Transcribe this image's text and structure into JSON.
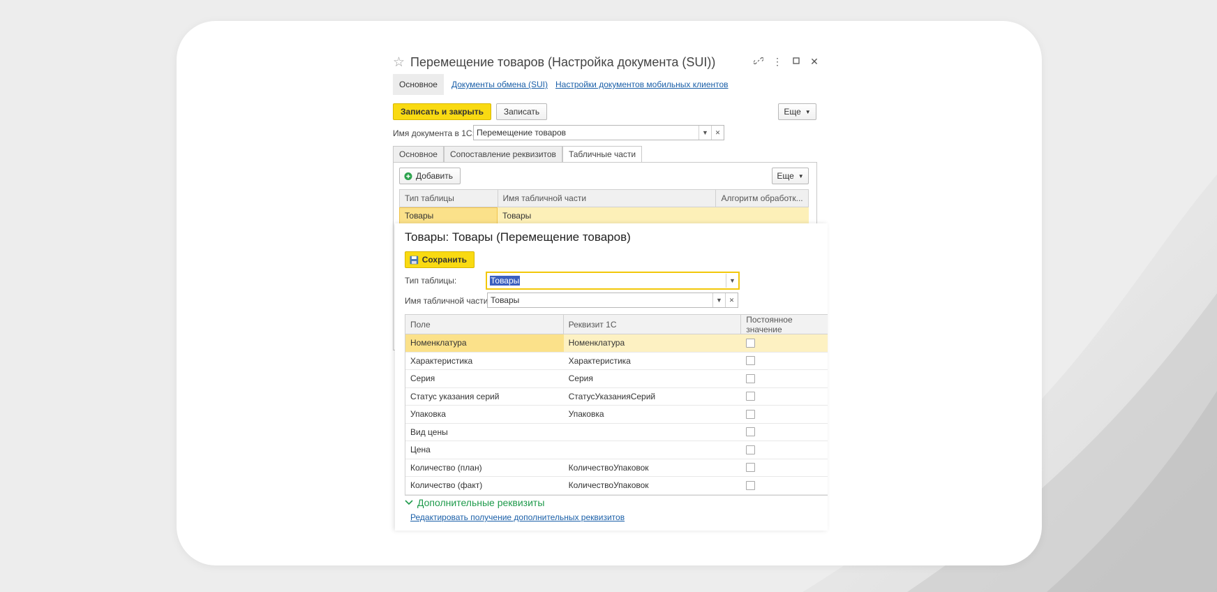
{
  "window": {
    "title": "Перемещение товаров (Настройка документа (SUI))",
    "controls": [
      "link-icon",
      "more-icon",
      "maximize-icon",
      "close-icon"
    ]
  },
  "top_tabs": {
    "active": "Основное",
    "links": [
      "Документы обмена (SUI)",
      "Настройки документов мобильных клиентов"
    ]
  },
  "toolbar": {
    "save_close": "Записать и закрыть",
    "save": "Записать",
    "more": "Еще"
  },
  "doc_name": {
    "label": "Имя документа в 1С:",
    "value": "Перемещение товаров"
  },
  "inner_tabs": [
    "Основное",
    "Сопоставление реквизитов",
    "Табличные части"
  ],
  "panel": {
    "add": "Добавить",
    "more": "Еще",
    "columns": [
      "Тип таблицы",
      "Имя табличной части",
      "Алгоритм обработк..."
    ],
    "row": [
      "Товары",
      "Товары",
      ""
    ]
  },
  "popup": {
    "title": "Товары: Товары (Перемещение товаров)",
    "save": "Сохранить",
    "table_type_label": "Тип таблицы:",
    "table_type_value": "Товары",
    "table_part_label": "Имя табличной части:",
    "table_part_value": "Товары",
    "columns": [
      "Поле",
      "Реквизит 1С",
      "Постоянное значение"
    ],
    "rows": [
      {
        "field": "Номенклатура",
        "attr": "Номенклатура"
      },
      {
        "field": "Характеристика",
        "attr": "Характеристика"
      },
      {
        "field": "Серия",
        "attr": "Серия"
      },
      {
        "field": "Статус указания серий",
        "attr": "СтатусУказанияСерий"
      },
      {
        "field": "Упаковка",
        "attr": "Упаковка"
      },
      {
        "field": "Вид цены",
        "attr": ""
      },
      {
        "field": "Цена",
        "attr": ""
      },
      {
        "field": "Количество (план)",
        "attr": "КоличествоУпаковок"
      },
      {
        "field": "Количество (факт)",
        "attr": "КоличествоУпаковок"
      }
    ],
    "extra_section": "Дополнительные реквизиты",
    "extra_link": "Редактировать получение дополнительных реквизитов"
  },
  "colors": {
    "accent_yellow": "#f9da12",
    "row_highlight": "#fdf1c2",
    "link_blue": "#1a5fa8",
    "section_green": "#1e9a4b"
  }
}
